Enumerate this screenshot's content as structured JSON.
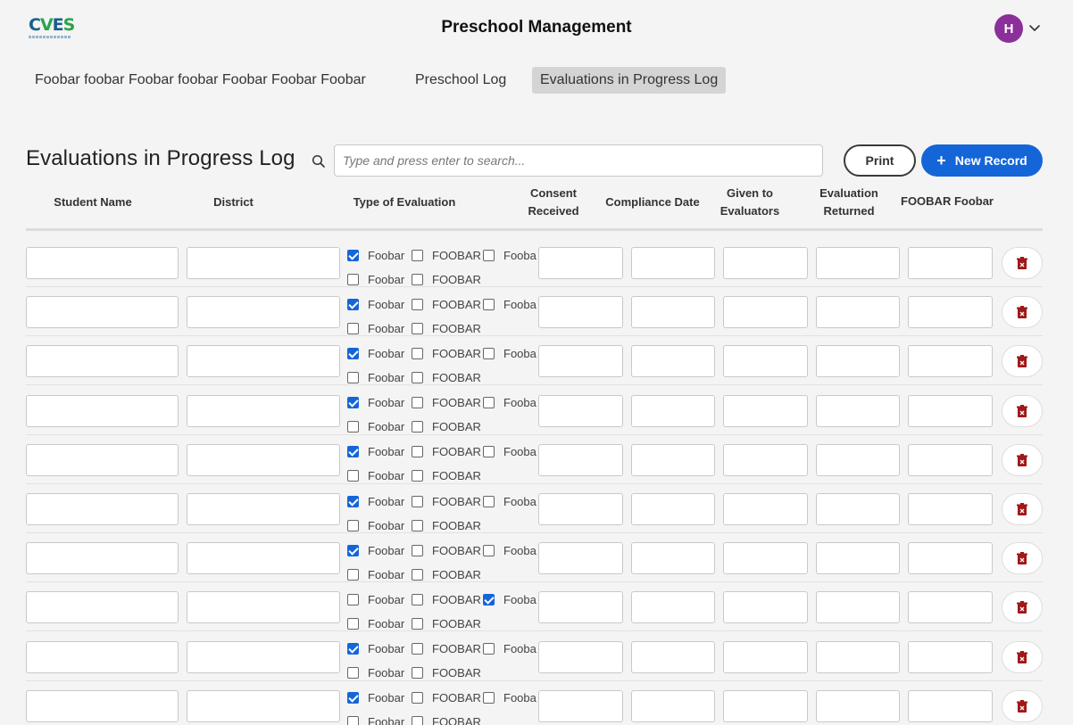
{
  "header": {
    "logo_text": "CVES",
    "app_title": "Preschool Management",
    "avatar_initial": "H"
  },
  "nav": {
    "tabs": [
      {
        "label": "Foobar foobar Foobar foobar Foobar Foobar Foobar",
        "active": false
      },
      {
        "label": "Preschool Log",
        "active": false
      },
      {
        "label": "Evaluations in Progress Log",
        "active": true
      }
    ]
  },
  "toolbar": {
    "heading": "Evaluations in Progress Log",
    "search_placeholder": "Type and press enter to search...",
    "print_label": "Print",
    "new_record_label": "New Record",
    "new_record_icon": "+"
  },
  "columns": {
    "student_name": "Student Name",
    "district": "District",
    "type_of_evaluation": "Type of Evaluation",
    "consent_line1": "Consent",
    "consent_line2": "Received",
    "compliance_date": "Compliance Date",
    "given_line1": "Given to",
    "given_line2": "Evaluators",
    "returned_line1": "Evaluation",
    "returned_line2": "Returned",
    "foobar_foobar": "FOOBAR Foobar"
  },
  "evaluation_option_labels": [
    "Foobar",
    "FOOBAR",
    "Foobar",
    "Foobar",
    "FOOBAR"
  ],
  "rows": [
    {
      "checked": [
        true,
        false,
        false,
        false,
        false
      ]
    },
    {
      "checked": [
        true,
        false,
        false,
        false,
        false
      ]
    },
    {
      "checked": [
        true,
        false,
        false,
        false,
        false
      ]
    },
    {
      "checked": [
        true,
        false,
        false,
        false,
        false
      ]
    },
    {
      "checked": [
        true,
        false,
        false,
        false,
        false
      ]
    },
    {
      "checked": [
        true,
        false,
        false,
        false,
        false
      ]
    },
    {
      "checked": [
        true,
        false,
        false,
        false,
        false
      ]
    },
    {
      "checked": [
        false,
        false,
        true,
        false,
        false
      ]
    },
    {
      "checked": [
        true,
        false,
        false,
        false,
        false
      ]
    },
    {
      "checked": [
        true,
        false,
        false,
        false,
        false
      ]
    }
  ],
  "colors": {
    "accent": "#1466d8",
    "avatar": "#8b2f9a",
    "delete_icon": "#a01818",
    "active_tab_bg": "#d4d4d4"
  },
  "icons": {
    "search": "search-icon",
    "chevron": "chevron-down-icon",
    "delete": "trash-icon"
  }
}
